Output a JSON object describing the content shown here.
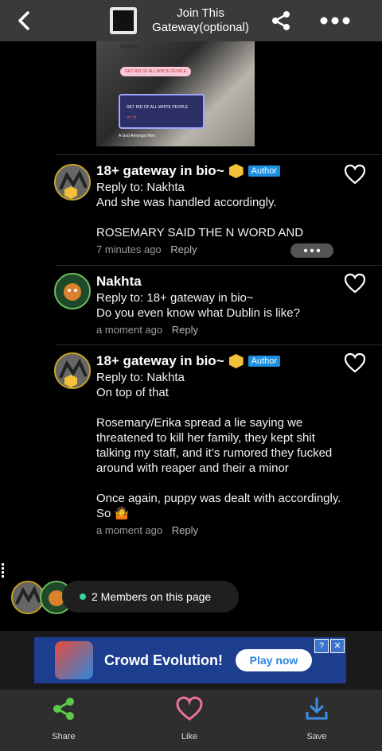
{
  "header": {
    "title_line1": "Join This",
    "title_line2": "Gateway(optional)",
    "back_icon": "chevron-left-icon",
    "share_icon": "share-icon",
    "more_icon": "more-dots-icon"
  },
  "post_image": {
    "caption_top": "Lightskin",
    "chip1": "GET RID OF ALL WHITE PEOPLE",
    "box_text1": "GET RID OF ALL WHITE PEOPLE",
    "box_text2": "?? ??",
    "caption_bottom": "A God Amongst Men"
  },
  "comments": [
    {
      "author": "18+ gateway in bio~",
      "author_tag": "Author",
      "reply_to": "Reply to: Nakhta",
      "text": "And she was handled accordingly.\n\nROSEMARY SAID THE N WORD AND",
      "time": "7 minutes ago",
      "reply_label": "Reply"
    },
    {
      "author": "Nakhta",
      "reply_to": "Reply to: 18+ gateway in bio~",
      "text": "Do you even know what Dublin is like?",
      "time": "a moment ago",
      "reply_label": "Reply"
    },
    {
      "author": "18+ gateway in bio~",
      "author_tag": "Author",
      "reply_to": "Reply to: Nakhta",
      "text": "On top of that\n\nRosemary/Erika spread a lie saying we threatened to kill her family, they kept shit talking my staff, and it’s rumored they fucked around with reaper and their a minor\n\nOnce again, puppy was dealt with accordingly. So 🤷",
      "time": "a moment ago",
      "reply_label": "Reply"
    }
  ],
  "members": {
    "text": "2 Members on this page"
  },
  "ad": {
    "title": "Crowd Evolution!",
    "button": "Play now",
    "info": "?",
    "close": "✕"
  },
  "bottom_bar": {
    "share": "Share",
    "like": "Like",
    "save": "Save"
  },
  "colors": {
    "accent_blue": "#1b8fe0",
    "online_green": "#38d39f",
    "like_pink": "#e8729a",
    "share_green": "#5ec84a",
    "save_blue": "#3a8ee6"
  }
}
